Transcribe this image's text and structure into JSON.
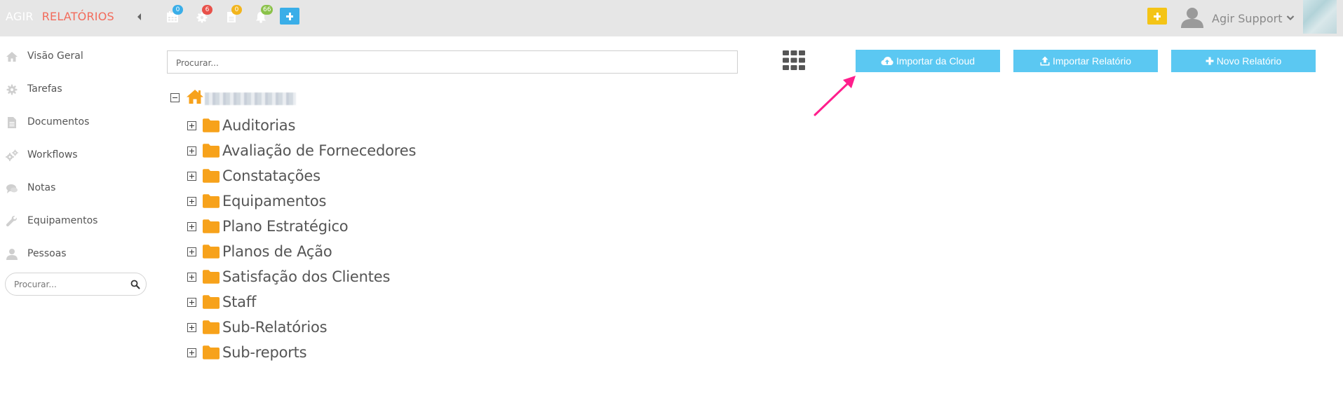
{
  "app": {
    "brand_primary": "AGIR",
    "brand_secondary": "RELATÓRIOS"
  },
  "colors": {
    "accent_blue": "#5bc8f2",
    "folder_orange": "#f7a21b",
    "brand_red": "#f26b5b",
    "annotation_arrow": "#ff1e8c"
  },
  "topbar": {
    "icons": [
      {
        "icon": "calendar-icon",
        "badge": "0",
        "badge_color": "blue"
      },
      {
        "icon": "gear-icon",
        "badge": "6",
        "badge_color": "red"
      },
      {
        "icon": "document-icon",
        "badge": "0",
        "badge_color": "yellow"
      },
      {
        "icon": "bell-icon",
        "badge": "66",
        "badge_color": "green"
      }
    ],
    "user_name": "Agir Support"
  },
  "sidebar": {
    "items": [
      {
        "label": "Visão Geral",
        "icon": "home-icon"
      },
      {
        "label": "Tarefas",
        "icon": "cog-icon"
      },
      {
        "label": "Documentos",
        "icon": "file-icon"
      },
      {
        "label": "Workflows",
        "icon": "cogs-icon"
      },
      {
        "label": "Notas",
        "icon": "chat-icon"
      },
      {
        "label": "Equipamentos",
        "icon": "wrench-icon"
      },
      {
        "label": "Pessoas",
        "icon": "person-icon"
      }
    ],
    "search_placeholder": "Procurar..."
  },
  "main": {
    "search_placeholder": "Procurar...",
    "buttons": {
      "import_cloud": "Importar da Cloud",
      "import_report": "Importar Relatório",
      "new_report": "Novo Relatório"
    },
    "tree": {
      "folders": [
        "Auditorias",
        "Avaliação de Fornecedores",
        "Constatações",
        "Equipamentos",
        "Plano Estratégico",
        "Planos de Ação",
        "Satisfação dos Clientes",
        "Staff",
        "Sub-Relatórios",
        "Sub-reports"
      ]
    }
  }
}
